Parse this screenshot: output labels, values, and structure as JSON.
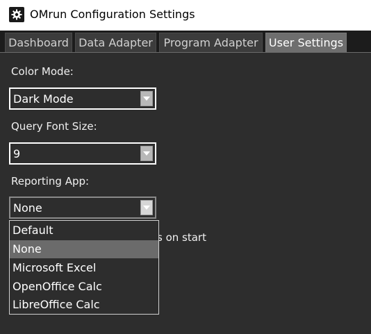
{
  "window": {
    "title": "OMrun Configuration Settings",
    "icon": "gear-icon"
  },
  "tabs": [
    {
      "label": "Dashboard",
      "active": false
    },
    {
      "label": "Data Adapter",
      "active": false
    },
    {
      "label": "Program Adapter",
      "active": false
    },
    {
      "label": "User Settings",
      "active": true
    }
  ],
  "settings": {
    "color_mode": {
      "label": "Color Mode:",
      "value": "Dark Mode"
    },
    "query_font_size": {
      "label": "Query Font Size:",
      "value": "9"
    },
    "reporting_app": {
      "label": "Reporting App:",
      "value": "None",
      "options": [
        "Default",
        "None",
        "Microsoft Excel",
        "OpenOffice Calc",
        "LibreOffice Calc"
      ],
      "selected_index": 1
    },
    "partially_hidden_option_text": "s on start"
  },
  "colors": {
    "background": "#2d2d2d",
    "tab_active": "#6e6e6e",
    "selection": "#6b6b6b",
    "titlebar": "#ffffff"
  }
}
